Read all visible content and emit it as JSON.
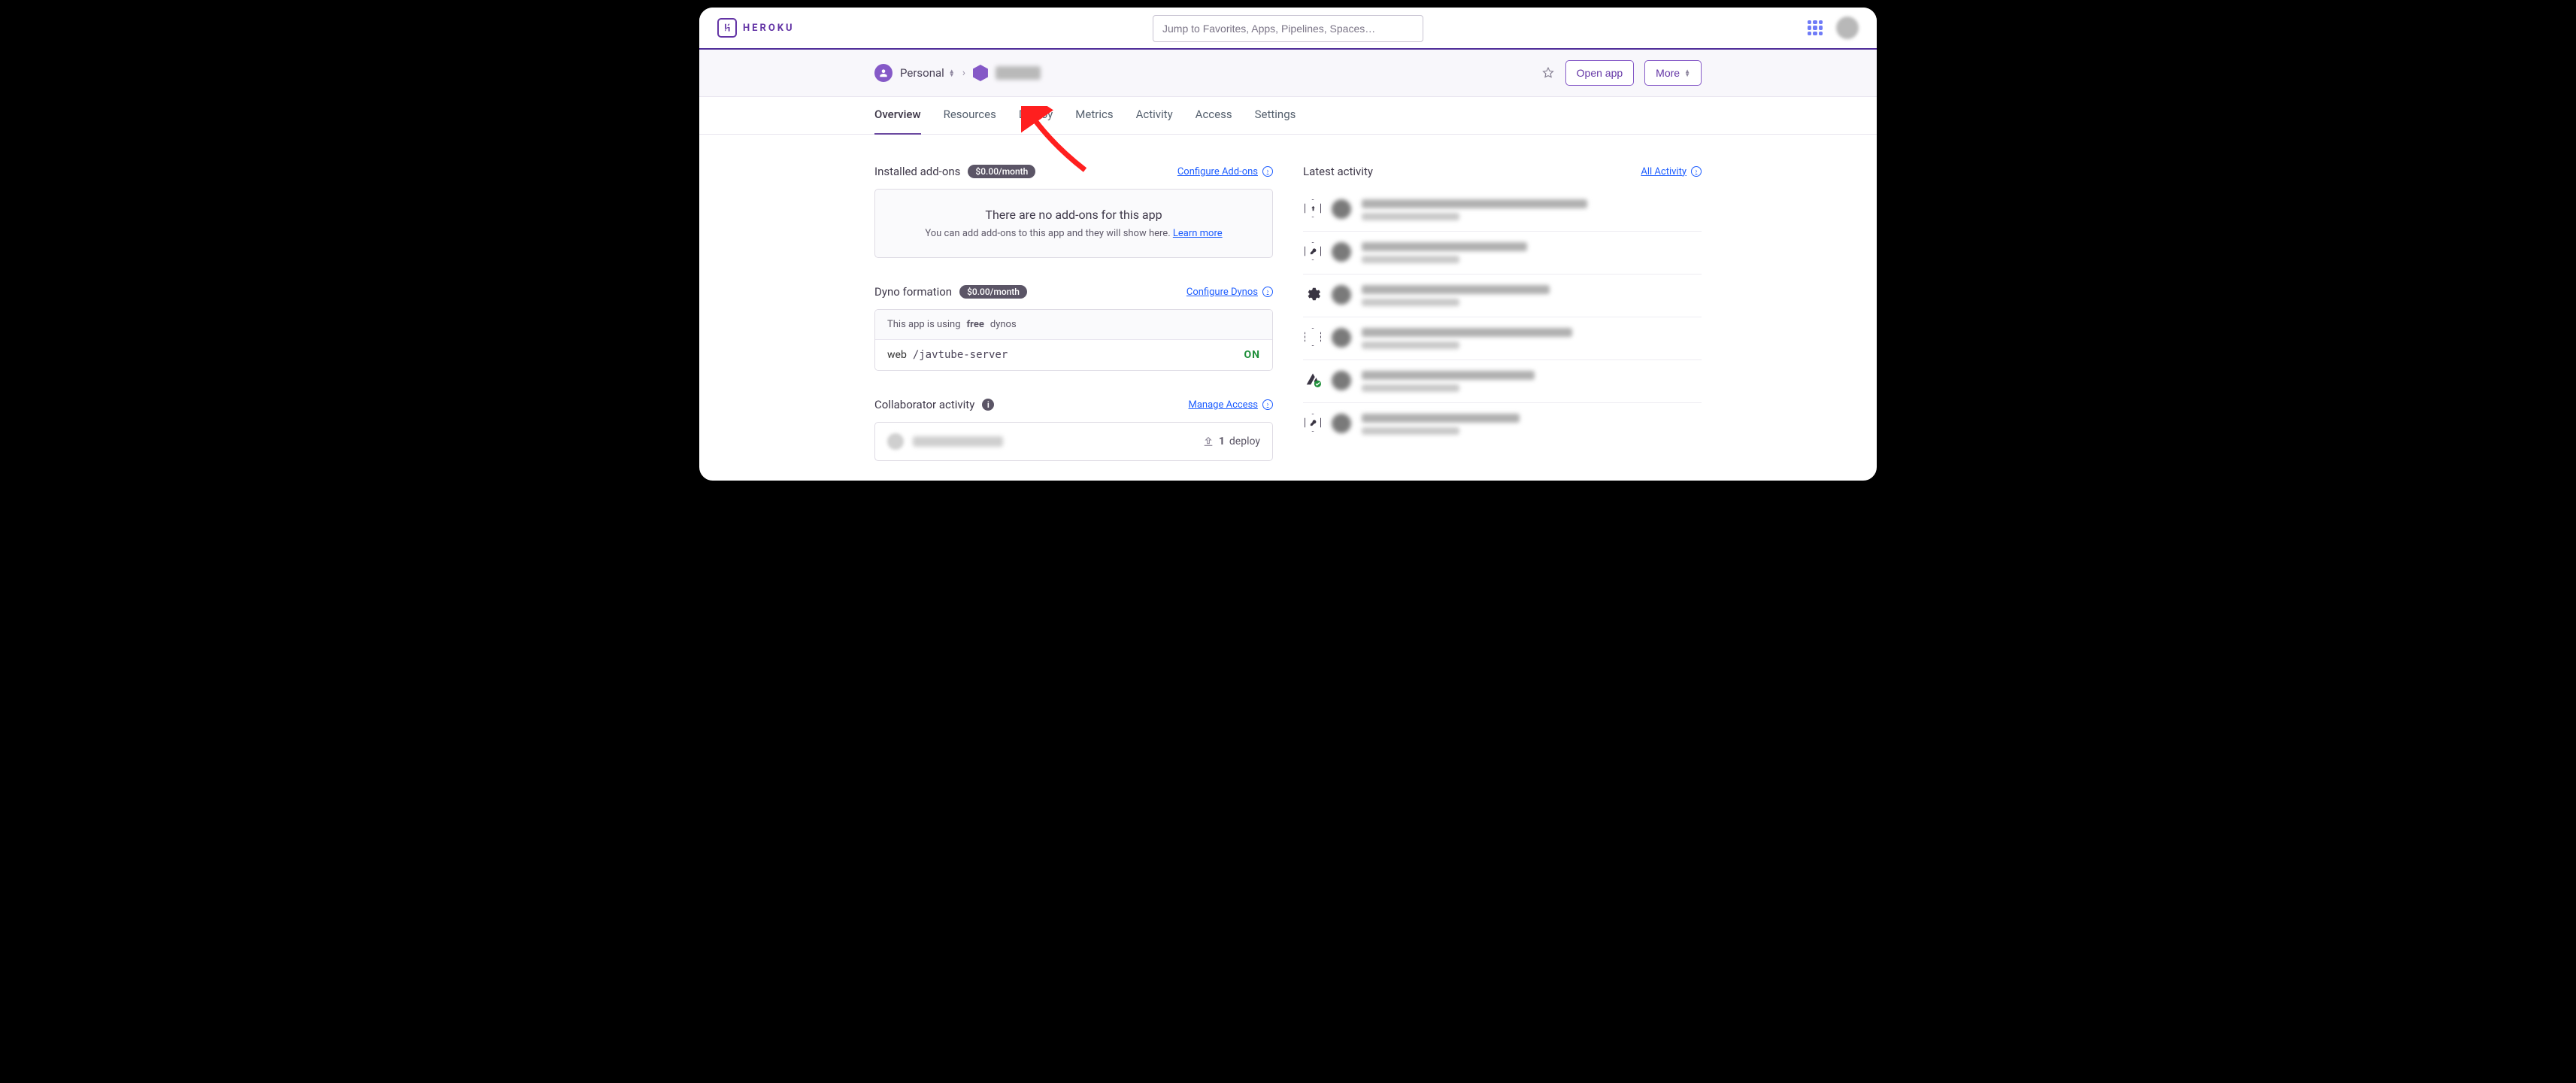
{
  "header": {
    "brand": "HEROKU",
    "jump_placeholder": "Jump to Favorites, Apps, Pipelines, Spaces…"
  },
  "subheader": {
    "team": "Personal",
    "open_app": "Open app",
    "more": "More"
  },
  "tabs": {
    "overview": "Overview",
    "resources": "Resources",
    "deploy": "Deploy",
    "metrics": "Metrics",
    "activity": "Activity",
    "access": "Access",
    "settings": "Settings",
    "active": "overview"
  },
  "addons": {
    "title": "Installed add-ons",
    "price": "$0.00/month",
    "configure": "Configure Add-ons",
    "empty_title": "There are no add-ons for this app",
    "empty_sub_a": "You can add add-ons to this app and they will show here. ",
    "empty_sub_link": "Learn more"
  },
  "dynos": {
    "title": "Dyno formation",
    "price": "$0.00/month",
    "configure": "Configure Dynos",
    "free_row_a": "This app is using ",
    "free_row_b": "free",
    "free_row_c": " dynos",
    "proc": "web",
    "cmd": "/javtube-server",
    "status": "ON"
  },
  "collab": {
    "title": "Collaborator activity",
    "manage": "Manage Access",
    "count": "1",
    "count_label": "deploy"
  },
  "activity": {
    "title": "Latest activity",
    "all": "All Activity"
  }
}
